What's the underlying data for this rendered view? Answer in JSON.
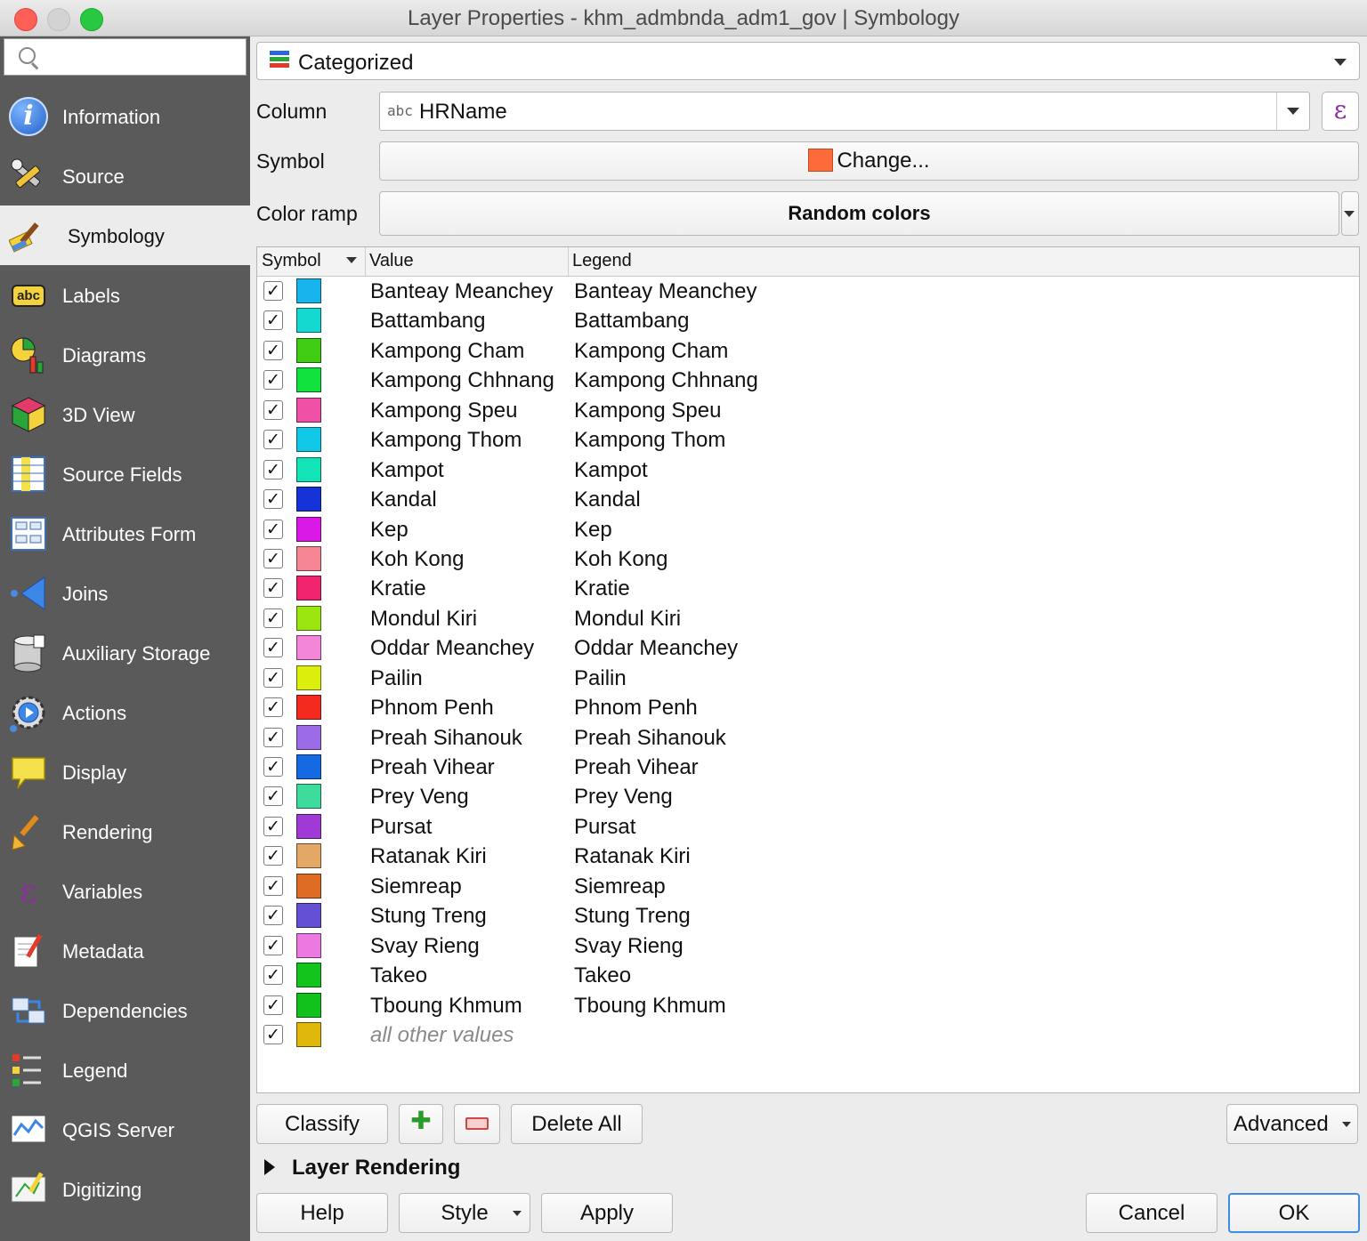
{
  "window": {
    "title": "Layer Properties - khm_admbnda_adm1_gov | Symbology"
  },
  "search": {
    "placeholder": ""
  },
  "sidebar": {
    "items": [
      {
        "label": "Information",
        "icon": "information-icon"
      },
      {
        "label": "Source",
        "icon": "source-tools-icon"
      },
      {
        "label": "Symbology",
        "icon": "paintbrush-icon",
        "active": true
      },
      {
        "label": "Labels",
        "icon": "abc-label-icon"
      },
      {
        "label": "Diagrams",
        "icon": "diagram-chart-icon"
      },
      {
        "label": "3D View",
        "icon": "cube-icon"
      },
      {
        "label": "Source Fields",
        "icon": "table-fields-icon"
      },
      {
        "label": "Attributes Form",
        "icon": "form-icon"
      },
      {
        "label": "Joins",
        "icon": "join-icon"
      },
      {
        "label": "Auxiliary Storage",
        "icon": "database-icon"
      },
      {
        "label": "Actions",
        "icon": "gear-play-icon"
      },
      {
        "label": "Display",
        "icon": "speech-bubble-icon"
      },
      {
        "label": "Rendering",
        "icon": "brush-icon"
      },
      {
        "label": "Variables",
        "icon": "epsilon-icon"
      },
      {
        "label": "Metadata",
        "icon": "document-pen-icon"
      },
      {
        "label": "Dependencies",
        "icon": "dependencies-icon"
      },
      {
        "label": "Legend",
        "icon": "legend-icon"
      },
      {
        "label": "QGIS Server",
        "icon": "server-map-icon"
      },
      {
        "label": "Digitizing",
        "icon": "digitizing-icon"
      }
    ]
  },
  "symbology": {
    "renderer": "Categorized",
    "column_label": "Column",
    "column_type": "abc",
    "column_value": "HRName",
    "symbol_label": "Symbol",
    "symbol_button": "Change...",
    "symbol_color": "#fd6b3b",
    "ramp_label": "Color ramp",
    "ramp_value": "Random colors",
    "headers": {
      "symbol": "Symbol",
      "value": "Value",
      "legend": "Legend"
    },
    "categories": [
      {
        "value": "Banteay Meanchey",
        "legend": "Banteay Meanchey",
        "color": "#18b4ee",
        "checked": true
      },
      {
        "value": "Battambang",
        "legend": "Battambang",
        "color": "#14d9d0",
        "checked": true
      },
      {
        "value": "Kampong Cham",
        "legend": "Kampong Cham",
        "color": "#3fcc12",
        "checked": true
      },
      {
        "value": "Kampong Chhnang",
        "legend": "Kampong Chhnang",
        "color": "#12e23e",
        "checked": true
      },
      {
        "value": "Kampong Speu",
        "legend": "Kampong Speu",
        "color": "#f050a6",
        "checked": true
      },
      {
        "value": "Kampong Thom",
        "legend": "Kampong Thom",
        "color": "#12c8e8",
        "checked": true
      },
      {
        "value": "Kampot",
        "legend": "Kampot",
        "color": "#12e6b8",
        "checked": true
      },
      {
        "value": "Kandal",
        "legend": "Kandal",
        "color": "#1532d6",
        "checked": true
      },
      {
        "value": "Kep",
        "legend": "Kep",
        "color": "#d918e6",
        "checked": true
      },
      {
        "value": "Koh Kong",
        "legend": "Koh Kong",
        "color": "#f58593",
        "checked": true
      },
      {
        "value": "Kratie",
        "legend": "Kratie",
        "color": "#f0246e",
        "checked": true
      },
      {
        "value": "Mondul Kiri",
        "legend": "Mondul Kiri",
        "color": "#9be611",
        "checked": true
      },
      {
        "value": "Oddar Meanchey",
        "legend": "Oddar Meanchey",
        "color": "#f386d8",
        "checked": true
      },
      {
        "value": "Pailin",
        "legend": "Pailin",
        "color": "#dcee0c",
        "checked": true
      },
      {
        "value": "Phnom Penh",
        "legend": "Phnom Penh",
        "color": "#f42a1f",
        "checked": true
      },
      {
        "value": "Preah Sihanouk",
        "legend": "Preah Sihanouk",
        "color": "#9c6ce8",
        "checked": true
      },
      {
        "value": "Preah Vihear",
        "legend": "Preah Vihear",
        "color": "#1569e2",
        "checked": true
      },
      {
        "value": "Prey Veng",
        "legend": "Prey Veng",
        "color": "#3ddc9c",
        "checked": true
      },
      {
        "value": "Pursat",
        "legend": "Pursat",
        "color": "#a03ad6",
        "checked": true
      },
      {
        "value": "Ratanak Kiri",
        "legend": "Ratanak Kiri",
        "color": "#e3a866",
        "checked": true
      },
      {
        "value": "Siemreap",
        "legend": "Siemreap",
        "color": "#df6c24",
        "checked": true
      },
      {
        "value": "Stung Treng",
        "legend": "Stung Treng",
        "color": "#6450d4",
        "checked": true
      },
      {
        "value": "Svay Rieng",
        "legend": "Svay Rieng",
        "color": "#ec78e2",
        "checked": true
      },
      {
        "value": "Takeo",
        "legend": "Takeo",
        "color": "#12c41c",
        "checked": true
      },
      {
        "value": "Tboung Khmum",
        "legend": "Tboung Khmum",
        "color": "#12c21c",
        "checked": true
      },
      {
        "value": "all other values",
        "legend": "",
        "color": "#e0b80c",
        "checked": true,
        "other": true
      }
    ],
    "buttons": {
      "classify": "Classify",
      "delete_all": "Delete All",
      "advanced": "Advanced"
    },
    "layer_rendering": "Layer Rendering"
  },
  "footer": {
    "help": "Help",
    "style": "Style",
    "apply": "Apply",
    "cancel": "Cancel",
    "ok": "OK"
  }
}
